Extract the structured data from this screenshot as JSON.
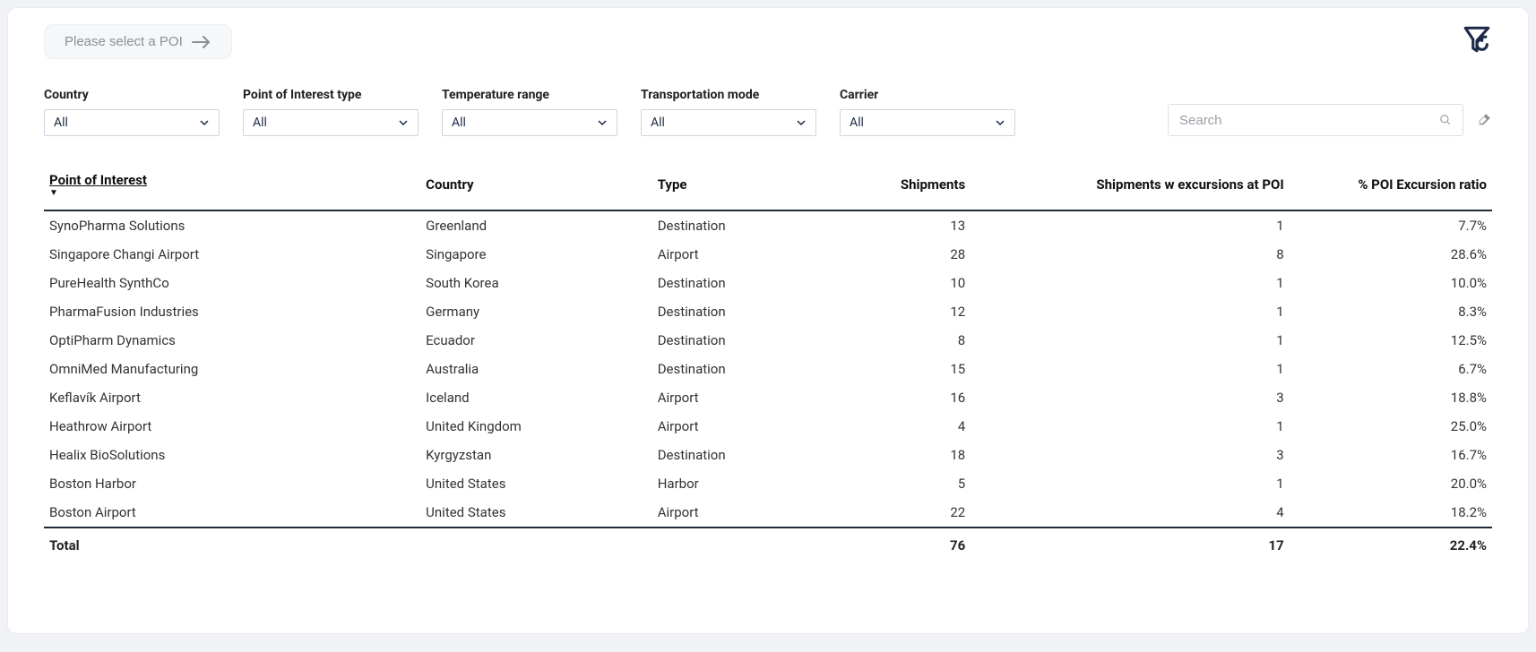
{
  "header": {
    "poi_select_label": "Please select a POI"
  },
  "filters": {
    "country": {
      "label": "Country",
      "value": "All"
    },
    "poi_type": {
      "label": "Point of Interest type",
      "value": "All"
    },
    "temp_range": {
      "label": "Temperature range",
      "value": "All"
    },
    "transport_mode": {
      "label": "Transportation mode",
      "value": "All"
    },
    "carrier": {
      "label": "Carrier",
      "value": "All"
    }
  },
  "search": {
    "placeholder": "Search",
    "value": ""
  },
  "table": {
    "columns": {
      "poi": "Point of Interest",
      "country": "Country",
      "type": "Type",
      "shipments": "Shipments",
      "excursions": "Shipments w excursions at POI",
      "ratio": "% POI Excursion ratio"
    },
    "rows": [
      {
        "poi": "SynoPharma Solutions",
        "country": "Greenland",
        "type": "Destination",
        "shipments": "13",
        "excursions": "1",
        "ratio": "7.7%"
      },
      {
        "poi": "Singapore Changi Airport",
        "country": "Singapore",
        "type": "Airport",
        "shipments": "28",
        "excursions": "8",
        "ratio": "28.6%"
      },
      {
        "poi": "PureHealth SynthCo",
        "country": "South Korea",
        "type": "Destination",
        "shipments": "10",
        "excursions": "1",
        "ratio": "10.0%"
      },
      {
        "poi": "PharmaFusion Industries",
        "country": "Germany",
        "type": "Destination",
        "shipments": "12",
        "excursions": "1",
        "ratio": "8.3%"
      },
      {
        "poi": "OptiPharm Dynamics",
        "country": "Ecuador",
        "type": "Destination",
        "shipments": "8",
        "excursions": "1",
        "ratio": "12.5%"
      },
      {
        "poi": "OmniMed Manufacturing",
        "country": "Australia",
        "type": "Destination",
        "shipments": "15",
        "excursions": "1",
        "ratio": "6.7%"
      },
      {
        "poi": "Keflavík Airport",
        "country": "Iceland",
        "type": "Airport",
        "shipments": "16",
        "excursions": "3",
        "ratio": "18.8%"
      },
      {
        "poi": "Heathrow Airport",
        "country": "United Kingdom",
        "type": "Airport",
        "shipments": "4",
        "excursions": "1",
        "ratio": "25.0%"
      },
      {
        "poi": "Healix BioSolutions",
        "country": "Kyrgyzstan",
        "type": "Destination",
        "shipments": "18",
        "excursions": "3",
        "ratio": "16.7%"
      },
      {
        "poi": "Boston Harbor",
        "country": "United States",
        "type": "Harbor",
        "shipments": "5",
        "excursions": "1",
        "ratio": "20.0%"
      },
      {
        "poi": "Boston Airport",
        "country": "United States",
        "type": "Airport",
        "shipments": "22",
        "excursions": "4",
        "ratio": "18.2%"
      }
    ],
    "total": {
      "label": "Total",
      "shipments": "76",
      "excursions": "17",
      "ratio": "22.4%"
    }
  }
}
